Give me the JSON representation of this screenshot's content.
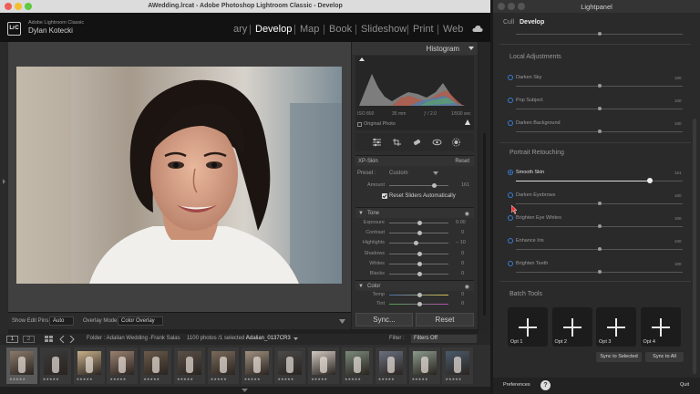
{
  "lightroom": {
    "window_title": "AWedding.lrcat - Adobe Photoshop Lightroom Classic - Develop",
    "app_name": "Adobe Lightroom Classic",
    "user_name": "Dylan Kotecki",
    "logo_text": "LrC",
    "modules": [
      "ary",
      "Develop",
      "Map",
      "Book",
      "Slideshow",
      "Print",
      "Web"
    ],
    "active_module": "Develop",
    "histogram_title": "Histogram",
    "histogram_meta": [
      "ISO 800",
      "35 mm",
      "ƒ / 2.0",
      "1/500 sec"
    ],
    "original_photo_label": "Original Photo",
    "xp_skin": {
      "header": "XP-Skin",
      "reset_label": "Reset",
      "preset_label": "Preset :",
      "preset_value": "Custom",
      "amount_label": "Amount",
      "amount_value": "161",
      "reset_sliders_label": "Reset Sliders Automatically"
    },
    "tone": {
      "header": "Tone",
      "sliders": [
        {
          "label": "Exposure",
          "value": "0.00",
          "level": 0.5
        },
        {
          "label": "Contrast",
          "value": "0",
          "level": 0.5
        },
        {
          "label": "Highlights",
          "value": "− 10",
          "level": 0.45
        },
        {
          "label": "Shadows",
          "value": "0",
          "level": 0.5
        },
        {
          "label": "Whites",
          "value": "0",
          "level": 0.5
        },
        {
          "label": "Blacks",
          "value": "0",
          "level": 0.5
        }
      ]
    },
    "color": {
      "header": "Color",
      "sliders": [
        {
          "label": "Temp",
          "value": "0",
          "level": 0.5
        },
        {
          "label": "Tint",
          "value": "0",
          "level": 0.5
        }
      ]
    },
    "sync_label": "Sync...",
    "reset_label": "Reset",
    "toolbar": {
      "show_edit_pins_label": "Show Edit Pins :",
      "show_edit_pins_value": "Auto",
      "overlay_mode_label": "Overlay Mode :",
      "overlay_mode_value": "Color Overlay"
    },
    "filmstrip_nav": {
      "page_buttons": [
        "1",
        "2"
      ],
      "folder_text": "Folder : Adalian Wedding -Frank Salas",
      "count_text": "1100 photos /1 selected /",
      "selected_file": "Adalian_0137CR3",
      "filter_label": "Filter :",
      "filter_value": "Filters Off"
    },
    "thumbnail_count": 14
  },
  "lightpanel": {
    "title": "Lightpanel",
    "tabs": [
      "Cull",
      "Develop"
    ],
    "active_tab": "Develop",
    "local_adjustments": {
      "header": "Local Adjustments",
      "items": [
        {
          "label": "Darken Sky",
          "value": "100",
          "level": 0.5
        },
        {
          "label": "Pop Subject",
          "value": "100",
          "level": 0.5
        },
        {
          "label": "Darken Background",
          "value": "100",
          "level": 0.5
        }
      ]
    },
    "portrait_retouching": {
      "header": "Portrait Retouching",
      "items": [
        {
          "label": "Smooth Skin",
          "value": "161",
          "level": 0.8,
          "active": true
        },
        {
          "label": "Darken Eyebrows",
          "value": "100",
          "level": 0.5,
          "active": false
        },
        {
          "label": "Brighten Eye Whites",
          "value": "100",
          "level": 0.5,
          "active": false
        },
        {
          "label": "Enhance Iris",
          "value": "100",
          "level": 0.5,
          "active": false
        },
        {
          "label": "Brighten Teeth",
          "value": "100",
          "level": 0.5,
          "active": false
        }
      ]
    },
    "batch_tools": {
      "header": "Batch Tools",
      "options": [
        "Opt 1",
        "Opt 2",
        "Opt 3",
        "Opt 4"
      ],
      "sync_to_selected": "Sync to Selected",
      "sync_to_all": "Sync to All"
    },
    "preferences_label": "Preferences",
    "help_label": "?",
    "quit_label": "Quit"
  },
  "colors": {
    "accent_blue": "#3a7bd5",
    "panel_bg": "#2e2e2e",
    "photo_bg": "#404040"
  }
}
